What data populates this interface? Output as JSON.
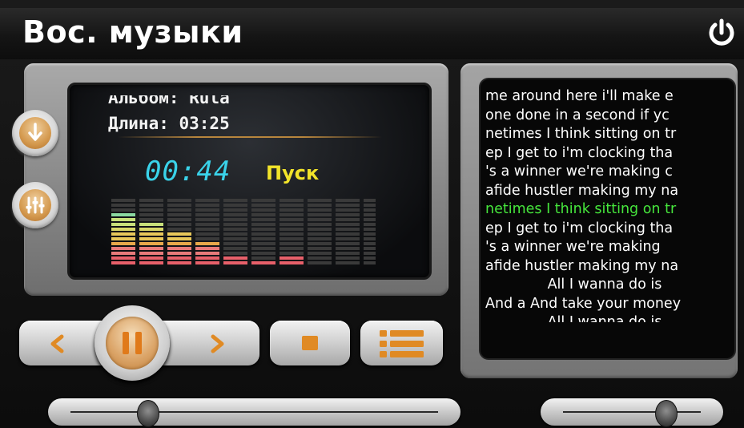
{
  "header": {
    "title": "Вос. музыки",
    "power_icon": "power-icon"
  },
  "player": {
    "album_line": "Альбом: Rula",
    "duration_line": "Длина: 03:25",
    "time": "00:44",
    "status": "Пуск",
    "equalizer_levels": [
      0.82,
      0.67,
      0.51,
      0.36,
      0.12,
      0.1,
      0.12,
      0.02,
      0.02,
      0.02
    ],
    "equalizer_colors": [
      "#e8606a",
      "#e87a7a",
      "#e8a84a",
      "#e8c85a",
      "#d8d86a",
      "#c8e07a",
      "#8ad8a0",
      "#5ad0c8"
    ]
  },
  "side_buttons": {
    "down_icon": "arrow-down-icon",
    "eq_icon": "equalizer-icon"
  },
  "transport": {
    "prev_icon": "chevron-left-icon",
    "pause_icon": "pause-icon",
    "next_icon": "chevron-right-icon",
    "stop_icon": "stop-icon",
    "playlist_icon": "playlist-icon",
    "accent": "#e08a24"
  },
  "lyrics": {
    "lines": [
      "me around here i'll make e",
      "one done in a second if yc",
      "netimes I think sitting on tr",
      "ep I get to i'm clocking tha",
      "'s a winner we're making c",
      "afide hustler making my na",
      "netimes I think sitting on tr",
      "ep I get to i'm clocking tha",
      "'s a winner  we're making",
      "afide hustler making my na",
      "All I wanna do is",
      "And a And take your money",
      "All I wanna do is"
    ],
    "active_index": 6,
    "active_color": "#46e63c"
  },
  "sliders": {
    "progress": 0.21,
    "volume": 0.72
  }
}
